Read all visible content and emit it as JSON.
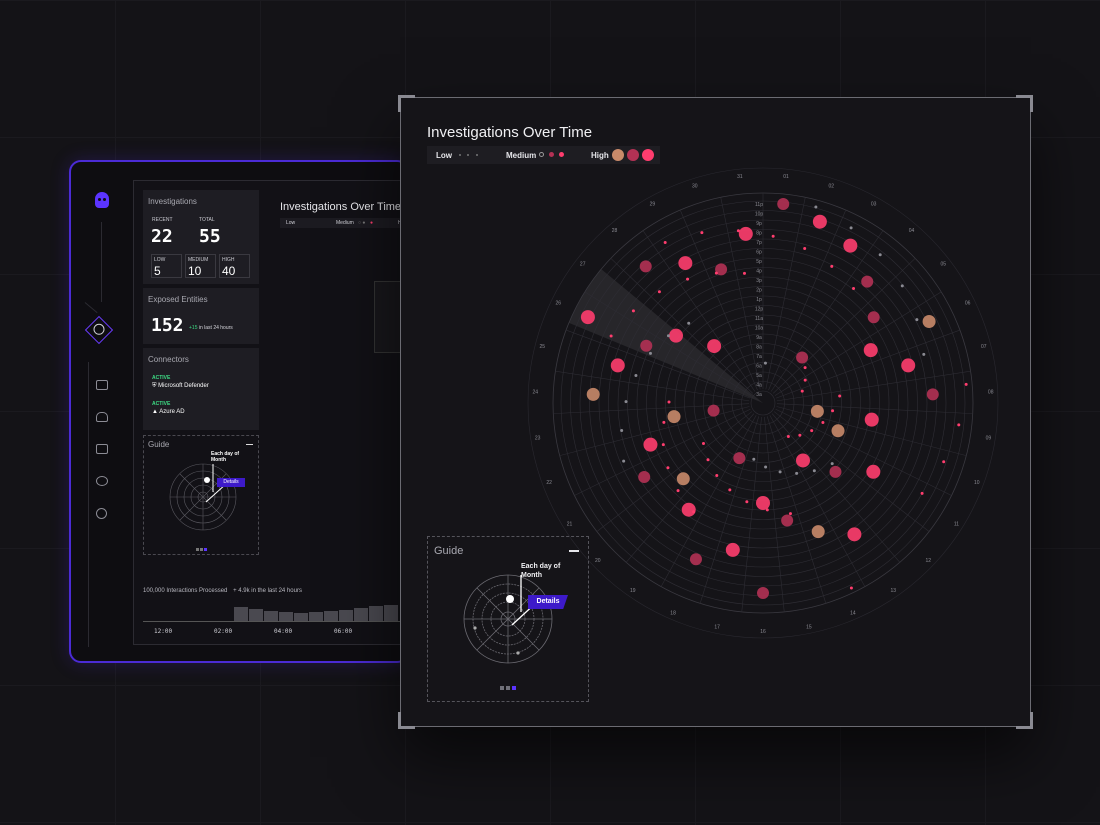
{
  "dashboard": {
    "investigations": {
      "title": "Investigations",
      "recent_label": "RECENT",
      "recent_value": "22",
      "total_label": "TOTAL",
      "total_value": "55",
      "low_label": "LOW",
      "low_value": "5",
      "medium_label": "MEDIUM",
      "medium_value": "10",
      "high_label": "HIGH",
      "high_value": "40"
    },
    "exposed": {
      "title": "Exposed Entities",
      "value": "152",
      "delta": "+15",
      "delta_suffix": "in last 24 hours"
    },
    "connectors": {
      "title": "Connectors",
      "items": [
        {
          "status": "ACTIVE",
          "name": "Microsoft Defender"
        },
        {
          "status": "ACTIVE",
          "name": "Azure AD"
        }
      ]
    },
    "interactions": {
      "label": "100,000 Interactions Processed",
      "delta": "+ 4.9k in the last 24 hours",
      "times": [
        "12:00",
        "02:00",
        "04:00",
        "06:00"
      ]
    },
    "small_chart_title": "Investigations Over Time",
    "small_legend": {
      "low": "Low",
      "medium": "Medium",
      "high": "H"
    }
  },
  "main": {
    "title": "Investigations Over Time",
    "legend": {
      "low": "Low",
      "medium": "Medium",
      "high": "High"
    },
    "guide": {
      "title": "Guide",
      "note": "Each day of Month",
      "details": "Details"
    },
    "day_labels": [
      "01",
      "02",
      "03",
      "04",
      "05",
      "06",
      "07",
      "08",
      "09",
      "10",
      "11",
      "12",
      "13",
      "14",
      "15",
      "16",
      "17",
      "18",
      "19",
      "20",
      "21",
      "22",
      "23",
      "24",
      "25",
      "26",
      "27",
      "28",
      "29",
      "30",
      "31"
    ],
    "hour_labels": [
      "11p",
      "10p",
      "9p",
      "8p",
      "7p",
      "6p",
      "5p",
      "4p",
      "3p",
      "2p",
      "1p",
      "12p",
      "11a",
      "10a",
      "9a",
      "8a",
      "7a",
      "6a",
      "5a",
      "4a",
      "3a"
    ]
  },
  "colors": {
    "high": "#ff3d6e",
    "medium": "#b33154",
    "low": "#c98a6a",
    "accent": "#5b34ff",
    "active_green": "#3ddc84"
  }
}
